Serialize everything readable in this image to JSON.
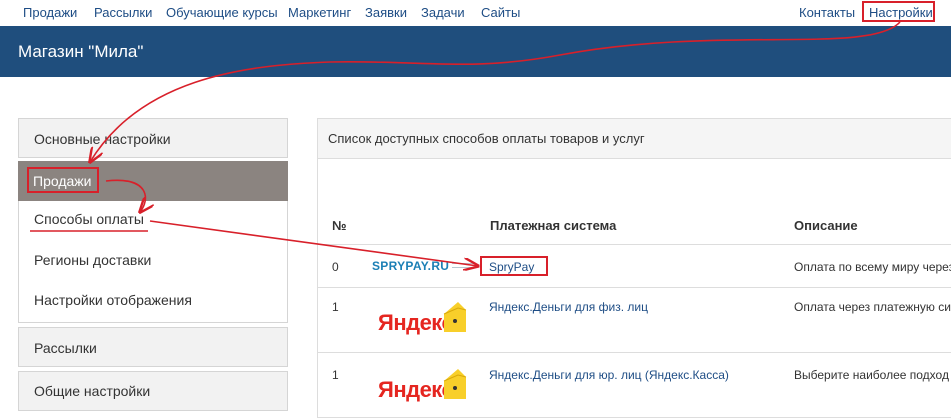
{
  "topnav": {
    "left": [
      "Продажи",
      "Рассылки",
      "Обучающие курсы",
      "Маркетинг",
      "Заявки",
      "Задачи",
      "Сайты"
    ],
    "contacts": "Контакты",
    "settings": "Настройки"
  },
  "header": {
    "title": "Магазин \"Мила\""
  },
  "sidebar": {
    "basic": "Основные настройки",
    "sales": "Продажи",
    "sub": [
      "Способы оплаты",
      "Регионы доставки",
      "Настройки отображения"
    ],
    "mailings": "Рассылки",
    "general": "Общие настройки"
  },
  "main": {
    "title": "Список доступных способов оплаты товаров и услуг",
    "columns": {
      "num": "№",
      "system": "Платежная система",
      "desc": "Описание"
    },
    "rows": [
      {
        "num": "0",
        "logo": "SPRYPAY.RU",
        "name": "SpryPay",
        "desc": "Оплата по всему миру через"
      },
      {
        "num": "1",
        "logo": "Яндекс",
        "name": "Яндекс.Деньги для физ. лиц",
        "desc": "Оплата через платежную сис"
      },
      {
        "num": "1",
        "logo": "Яндекс",
        "name": "Яндекс.Деньги для юр. лиц (Яндекс.Касса)",
        "desc": "Выберите наиболее подход"
      }
    ]
  },
  "colors": {
    "brand": "#1f4e7d",
    "link": "#1e4d85",
    "annotation": "#d8202a",
    "yandex_red": "#e52620",
    "yandex_yellow": "#f8cf2a"
  }
}
